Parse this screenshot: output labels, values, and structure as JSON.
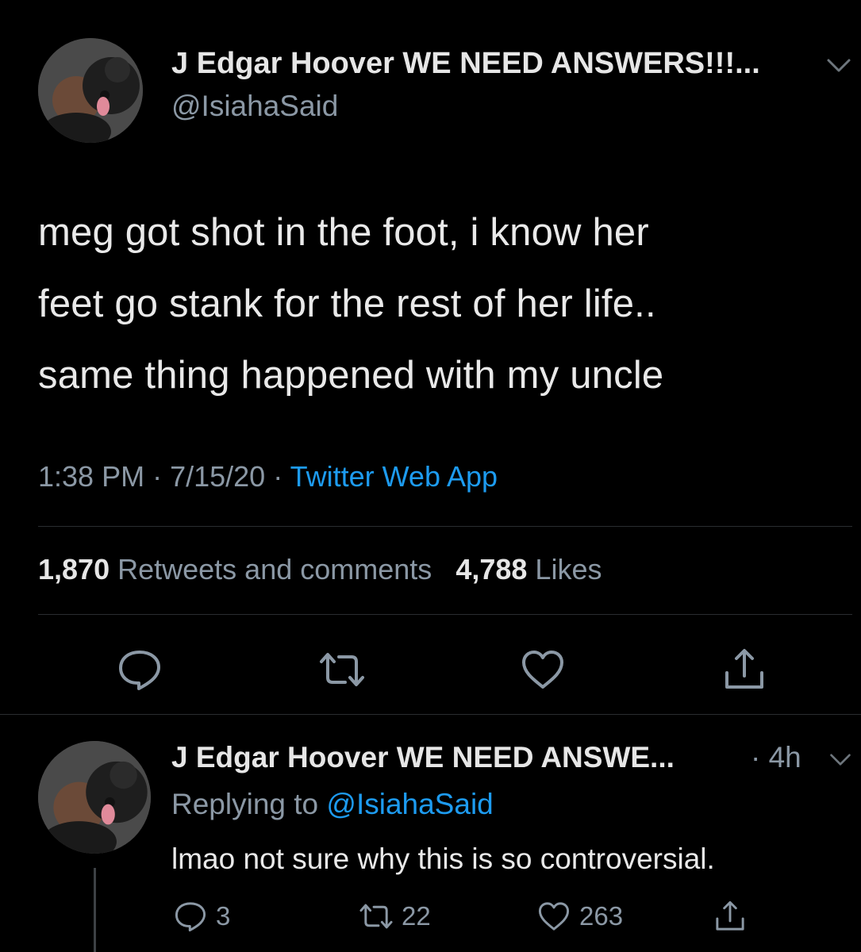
{
  "tweet": {
    "author_name": "J Edgar Hoover WE NEED ANSWERS!!!...",
    "author_handle": "@IsiahaSaid",
    "text_lines": [
      "meg got shot in the foot, i know her",
      "feet go stank for the rest of her life..",
      "same thing happened with my uncle"
    ],
    "time": "1:38 PM",
    "date": "7/15/20",
    "source": "Twitter Web App",
    "retweets_count": "1,870",
    "retweets_label": "Retweets and comments",
    "likes_count": "4,788",
    "likes_label": "Likes",
    "actions": [
      "reply-icon",
      "retweet-icon",
      "like-icon",
      "share-icon"
    ]
  },
  "reply": {
    "author_name": "J Edgar Hoover WE NEED ANSWE...",
    "time": "4h",
    "replying_prefix": "Replying to",
    "replying_to": "@IsiahaSaid",
    "text": "lmao not sure why this is so controversial.",
    "reply_count": "3",
    "retweet_count": "22",
    "like_count": "263"
  },
  "colors": {
    "background": "#000000",
    "text": "#e9e9e9",
    "secondary": "#8b98a5",
    "link": "#1d9bf0",
    "divider": "#2a2d30"
  }
}
